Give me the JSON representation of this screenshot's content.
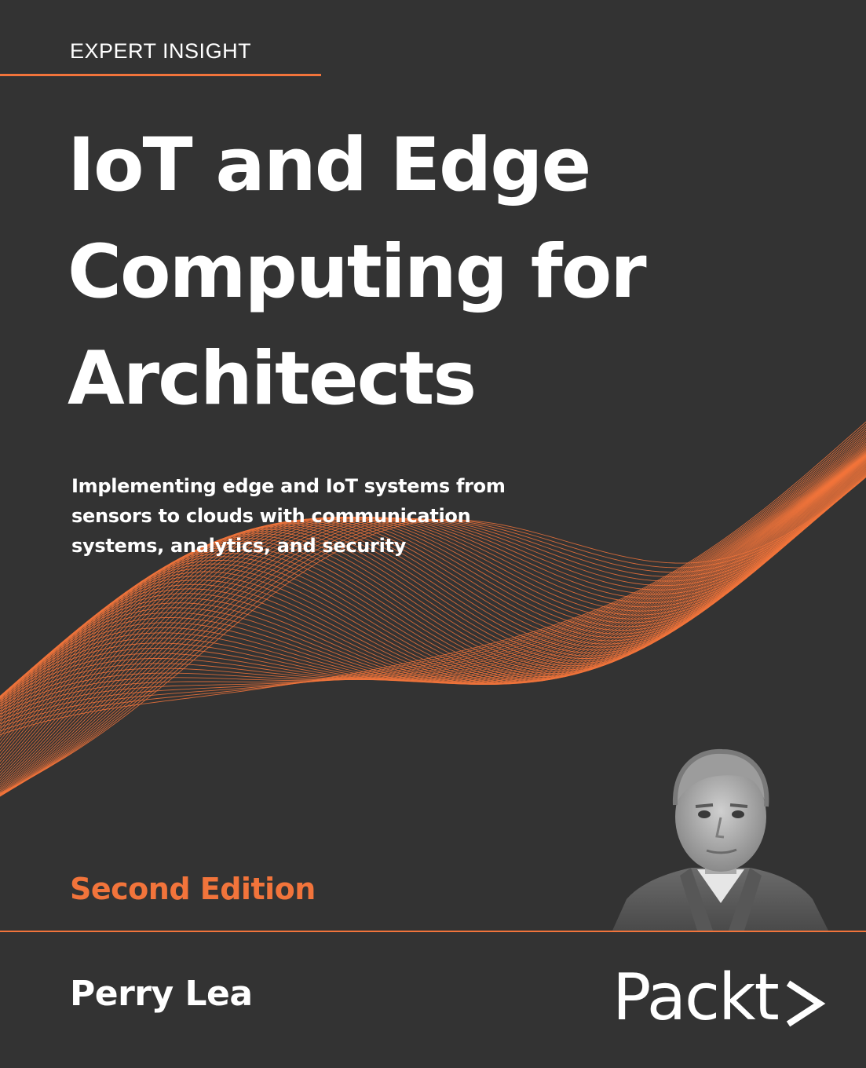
{
  "series_label": "EXPERT INSIGHT",
  "title_lines": [
    "IoT and Edge",
    "Computing for",
    "Architects"
  ],
  "subtitle_lines": [
    "Implementing edge and IoT systems from",
    "sensors to clouds with communication",
    "systems, analytics, and security"
  ],
  "edition": "Second Edition",
  "author": "Perry Lea",
  "publisher": "Packt",
  "colors": {
    "background": "#333333",
    "accent": "#f2743b",
    "text": "#ffffff"
  },
  "icons": {
    "logo_chevron": "right-angle-bracket-icon"
  }
}
